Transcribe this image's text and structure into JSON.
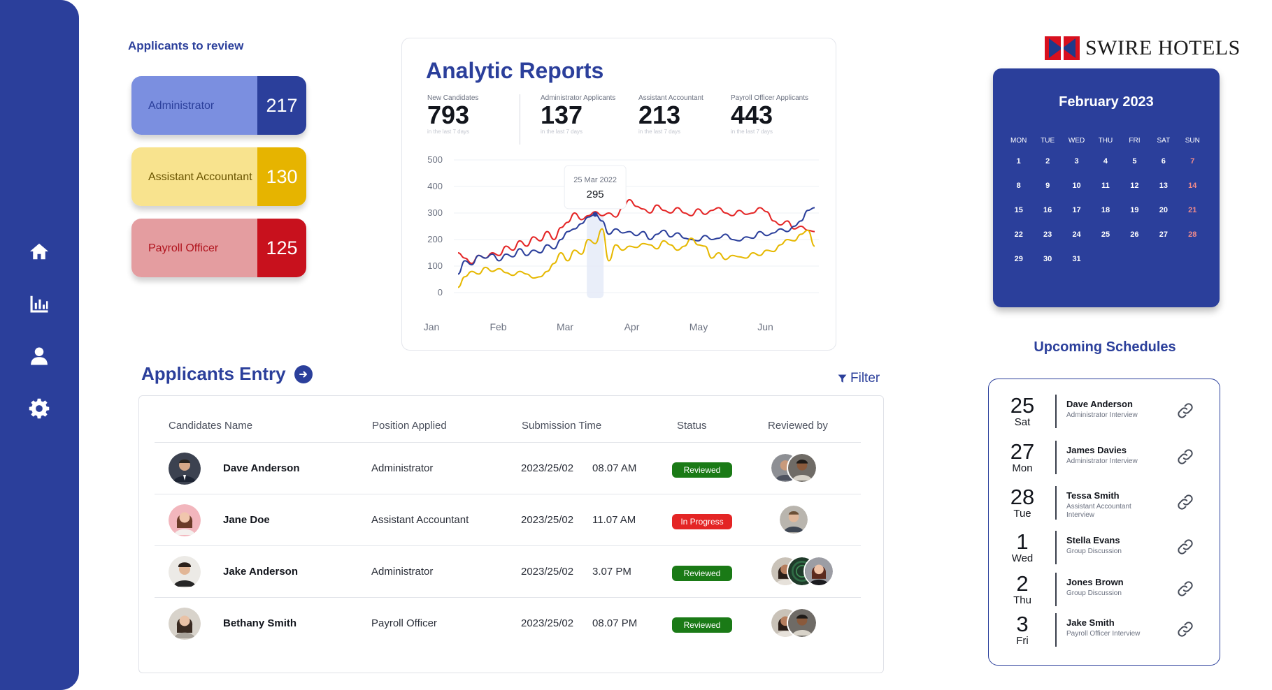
{
  "sidebar": {
    "items": [
      {
        "icon": "home-icon"
      },
      {
        "icon": "bar-chart-icon"
      },
      {
        "icon": "user-icon"
      },
      {
        "icon": "gear-icon"
      }
    ]
  },
  "review": {
    "title": "Applicants to review",
    "cards": [
      {
        "label": "Administrator",
        "count": "217"
      },
      {
        "label": "Assistant Accountant",
        "count": "130"
      },
      {
        "label": "Payroll Officer",
        "count": "125"
      }
    ]
  },
  "report": {
    "title": "Analytic Reports",
    "stats": [
      {
        "label": "New Candidates",
        "value": "793",
        "sub": "in the last 7 days"
      },
      {
        "label": "Administrator Applicants",
        "value": "137",
        "sub": "in the last 7 days"
      },
      {
        "label": "Assistant Accountant",
        "value": "213",
        "sub": "in the last 7 days"
      },
      {
        "label": "Payroll Officer Applicants",
        "value": "443",
        "sub": "in the last 7 days"
      }
    ],
    "tooltip": {
      "date": "25 Mar 2022",
      "value": "295"
    }
  },
  "chart_data": {
    "type": "line",
    "x": [
      "Jan",
      "Feb",
      "Mar",
      "Apr",
      "May",
      "Jun"
    ],
    "ylim": [
      0,
      500
    ],
    "yticks": [
      0,
      100,
      200,
      300,
      400,
      500
    ],
    "colors": {
      "red": "#e42525",
      "blue": "#2b3f9b",
      "yellow": "#e6b800"
    },
    "series": [
      {
        "color_key": "red",
        "values": [
          150,
          130,
          110,
          140,
          130,
          150,
          140,
          175,
          160,
          195,
          175,
          210,
          195,
          230,
          200,
          245,
          265,
          300,
          275,
          290,
          305,
          290,
          300,
          285,
          320,
          350,
          325,
          315,
          300,
          330,
          310,
          300,
          320,
          300,
          290,
          315,
          295,
          310,
          320,
          300,
          290,
          310,
          295,
          300,
          320,
          305,
          270,
          255,
          270,
          240,
          250,
          235,
          230
        ]
      },
      {
        "color_key": "blue",
        "values": [
          70,
          120,
          105,
          140,
          130,
          145,
          120,
          145,
          135,
          165,
          140,
          160,
          150,
          180,
          165,
          200,
          230,
          240,
          260,
          285,
          295,
          270,
          220,
          240,
          225,
          230,
          215,
          230,
          200,
          220,
          235,
          210,
          225,
          205,
          200,
          195,
          215,
          200,
          205,
          220,
          200,
          195,
          210,
          205,
          230,
          215,
          225,
          240,
          230,
          250,
          270,
          310,
          320
        ]
      },
      {
        "color_key": "yellow",
        "values": [
          20,
          60,
          80,
          70,
          95,
          80,
          90,
          75,
          65,
          80,
          70,
          55,
          60,
          80,
          110,
          150,
          120,
          160,
          145,
          200,
          185,
          240,
          120,
          180,
          160,
          175,
          170,
          185,
          180,
          165,
          195,
          180,
          160,
          175,
          205,
          180,
          175,
          130,
          150,
          125,
          140,
          135,
          130,
          150,
          140,
          160,
          155,
          180,
          200,
          195,
          220,
          235,
          175
        ]
      }
    ]
  },
  "entry": {
    "title": "Applicants Entry",
    "filter_label": "Filter",
    "columns": [
      "Candidates Name",
      "Position Applied",
      "Submission Time",
      "Status",
      "Reviewed by"
    ],
    "rows": [
      {
        "name": "Dave Anderson",
        "position": "Administrator",
        "date": "2023/25/02",
        "time": "08.07 AM",
        "status": "Reviewed",
        "status_kind": "ok"
      },
      {
        "name": "Jane Doe",
        "position": "Assistant Accountant",
        "date": "2023/25/02",
        "time": "11.07 AM",
        "status": "In Progress",
        "status_kind": "prog"
      },
      {
        "name": "Jake Anderson",
        "position": "Administrator",
        "date": "2023/25/02",
        "time": "3.07 PM",
        "status": "Reviewed",
        "status_kind": "ok"
      },
      {
        "name": "Bethany Smith",
        "position": "Payroll Officer",
        "date": "2023/25/02",
        "time": "08.07 PM",
        "status": "Reviewed",
        "status_kind": "ok"
      }
    ]
  },
  "logo": {
    "text": "SWIRE HOTELS",
    "colors": {
      "red": "#d8101e",
      "blue": "#1f3a8a"
    }
  },
  "calendar": {
    "title": "February 2023",
    "weekdays": [
      "MON",
      "TUE",
      "WED",
      "THU",
      "FRI",
      "SAT",
      "SUN"
    ],
    "days": [
      "1",
      "2",
      "3",
      "4",
      "5",
      "6",
      "7",
      "8",
      "9",
      "10",
      "11",
      "12",
      "13",
      "14",
      "15",
      "16",
      "17",
      "18",
      "19",
      "20",
      "21",
      "22",
      "23",
      "24",
      "25",
      "26",
      "27",
      "28",
      "29",
      "30",
      "31"
    ]
  },
  "schedules": {
    "title": "Upcoming Schedules",
    "items": [
      {
        "day": "25",
        "dow": "Sat",
        "name": "Dave Anderson",
        "type": "Administrator Interview"
      },
      {
        "day": "27",
        "dow": "Mon",
        "name": "James Davies",
        "type": "Administrator Interview"
      },
      {
        "day": "28",
        "dow": "Tue",
        "name": "Tessa Smith",
        "type": "Assistant Accountant Interview"
      },
      {
        "day": "1",
        "dow": "Wed",
        "name": "Stella Evans",
        "type": "Group Discussion"
      },
      {
        "day": "2",
        "dow": "Thu",
        "name": "Jones Brown",
        "type": "Group Discussion"
      },
      {
        "day": "3",
        "dow": "Fri",
        "name": "Jake Smith",
        "type": "Payroll Officer Interview"
      }
    ]
  }
}
